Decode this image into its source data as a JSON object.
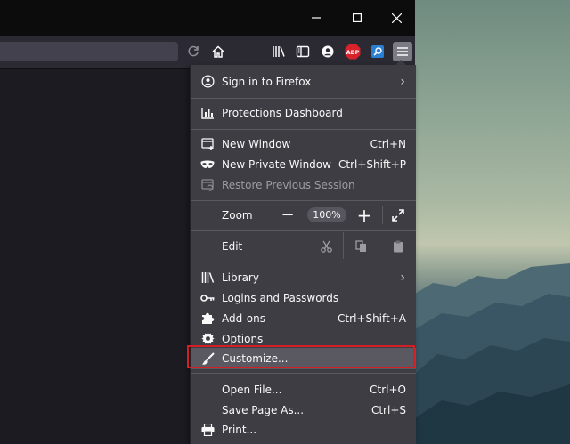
{
  "window": {
    "controls": {
      "minimize": "minimize",
      "maximize": "maximize",
      "close": "close"
    }
  },
  "toolbar": {
    "icons": [
      "reload-icon",
      "home-icon",
      "library-icon",
      "sidebar-icon",
      "account-icon",
      "adblock-icon",
      "extension-icon",
      "hamburger-menu-icon"
    ],
    "adblock_label": "ABP"
  },
  "menu": {
    "sign_in": "Sign in to Firefox",
    "protections": "Protections Dashboard",
    "new_window": {
      "label": "New Window",
      "shortcut": "Ctrl+N"
    },
    "new_private_window": {
      "label": "New Private Window",
      "shortcut": "Ctrl+Shift+P"
    },
    "restore_session": "Restore Previous Session",
    "zoom": {
      "label": "Zoom",
      "minus": "−",
      "value": "100%",
      "plus": "+"
    },
    "edit": {
      "label": "Edit"
    },
    "library": "Library",
    "logins": "Logins and Passwords",
    "addons": {
      "label": "Add-ons",
      "shortcut": "Ctrl+Shift+A"
    },
    "options": "Options",
    "customize": "Customize...",
    "open_file": {
      "label": "Open File...",
      "shortcut": "Ctrl+O"
    },
    "save_page": {
      "label": "Save Page As...",
      "shortcut": "Ctrl+S"
    },
    "print": "Print..."
  },
  "colors": {
    "highlight_border": "#d21f26",
    "panel_bg": "#3e3d44",
    "titlebar_bg": "#0c0c0d",
    "toolbar_bg": "#2b2a33"
  }
}
